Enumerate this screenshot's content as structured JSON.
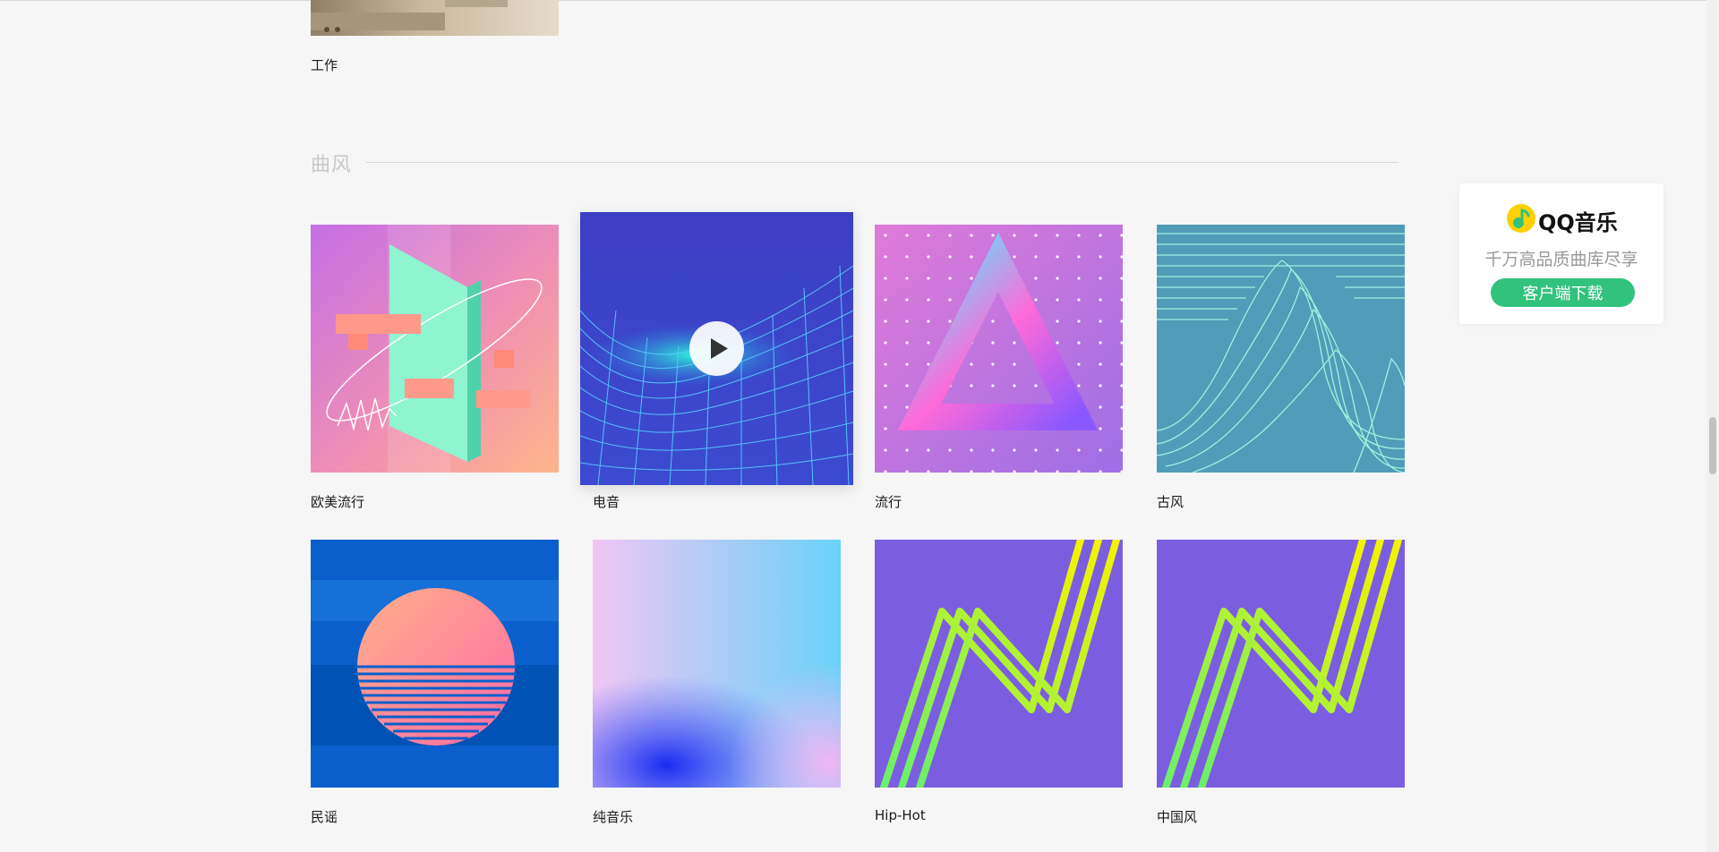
{
  "top_item": {
    "label": "工作"
  },
  "section": {
    "title": "曲风"
  },
  "genres": [
    {
      "label": "欧美流行"
    },
    {
      "label": "电音"
    },
    {
      "label": "流行"
    },
    {
      "label": "古风"
    },
    {
      "label": "民谣"
    },
    {
      "label": "纯音乐"
    },
    {
      "label": "Hip-Hot"
    },
    {
      "label": "中国风"
    }
  ],
  "ad": {
    "brand": "QQ音乐",
    "slogan": "千万高品质曲库尽享",
    "download_label": "客户端下载"
  },
  "colors": {
    "accent": "#31c27c",
    "logo_yellow": "#ffd000",
    "logo_green": "#31c27c"
  }
}
